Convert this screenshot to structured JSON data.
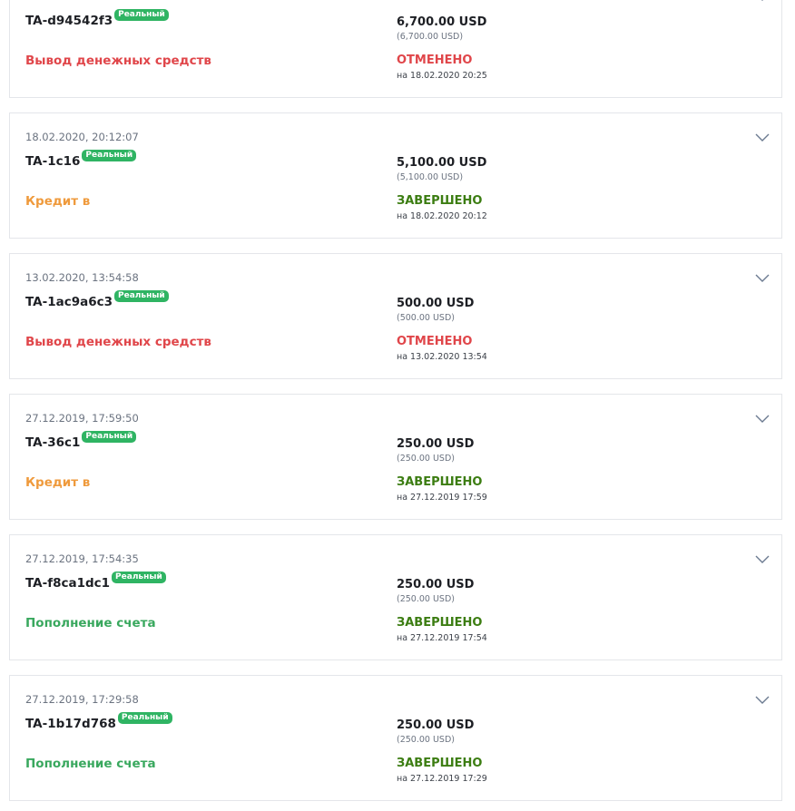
{
  "colors": {
    "withdraw_red": "#e0464a",
    "credit_orange": "#ef9a3c",
    "deposit_green": "#39a85e",
    "completed_green": "#3c7d12",
    "cancelled_red": "#e0464a",
    "badge_green": "#2fb463"
  },
  "transactions": [
    {
      "date": "",
      "id": "TA-d94542f3",
      "badge": "Реальный",
      "type": "Вывод денежных средств",
      "amount": "6,700.00 USD",
      "amount_sub": "(6,700.00 USD)",
      "status": "ОТМЕНЕНО",
      "status_date": "на 18.02.2020 20:25",
      "icon": "chevron-down-icon"
    },
    {
      "date": "18.02.2020, 20:12:07",
      "id": "TA-1c16",
      "badge": "Реальный",
      "type": "Кредит в",
      "amount": "5,100.00 USD",
      "amount_sub": "(5,100.00 USD)",
      "status": "ЗАВЕРШЕНО",
      "status_date": "на 18.02.2020 20:12",
      "icon": "chevron-down-icon"
    },
    {
      "date": "13.02.2020, 13:54:58",
      "id": "TA-1ac9a6c3",
      "badge": "Реальный",
      "type": "Вывод денежных средств",
      "amount": "500.00 USD",
      "amount_sub": "(500.00 USD)",
      "status": "ОТМЕНЕНО",
      "status_date": "на 13.02.2020 13:54",
      "icon": "chevron-down-icon"
    },
    {
      "date": "27.12.2019, 17:59:50",
      "id": "TA-36c1",
      "badge": "Реальный",
      "type": "Кредит в",
      "amount": "250.00 USD",
      "amount_sub": "(250.00 USD)",
      "status": "ЗАВЕРШЕНО",
      "status_date": "на 27.12.2019 17:59",
      "icon": "chevron-down-icon"
    },
    {
      "date": "27.12.2019, 17:54:35",
      "id": "TA-f8ca1dc1",
      "badge": "Реальный",
      "type": "Пополнение счета",
      "amount": "250.00 USD",
      "amount_sub": "(250.00 USD)",
      "status": "ЗАВЕРШЕНО",
      "status_date": "на 27.12.2019 17:54",
      "icon": "chevron-down-icon"
    },
    {
      "date": "27.12.2019, 17:29:58",
      "id": "TA-1b17d768",
      "badge": "Реальный",
      "type": "Пополнение счета",
      "amount": "250.00 USD",
      "amount_sub": "(250.00 USD)",
      "status": "ЗАВЕРШЕНО",
      "status_date": "на 27.12.2019 17:29",
      "icon": "chevron-down-icon"
    }
  ]
}
